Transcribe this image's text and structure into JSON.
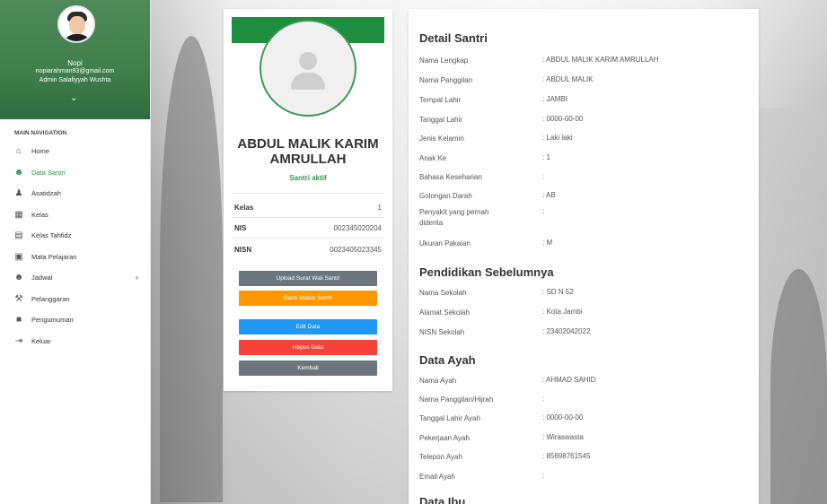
{
  "sidebar": {
    "user": {
      "name": "Nopi",
      "email": "nopiarahman93@gmail.com",
      "role": "Admin Salafiyyah Wushta"
    },
    "nav_header": "MAIN NAVIGATION",
    "items": [
      {
        "label": "Home",
        "icon": "home-icon"
      },
      {
        "label": "Data Santri",
        "icon": "users-icon"
      },
      {
        "label": "Asatidzah",
        "icon": "user-icon"
      },
      {
        "label": "Kelas",
        "icon": "building-icon"
      },
      {
        "label": "Kelas Tahfidz",
        "icon": "book-icon"
      },
      {
        "label": "Mata Pelajaran",
        "icon": "file-icon"
      },
      {
        "label": "Jadwal",
        "icon": "users-icon",
        "expand": "+"
      },
      {
        "label": "Pelanggaran",
        "icon": "gavel-icon"
      },
      {
        "label": "Pengumuman",
        "icon": "announcement-icon"
      },
      {
        "label": "Keluar",
        "icon": "logout-icon"
      }
    ]
  },
  "profile": {
    "name": "ABDUL MALIK KARIM AMRULLAH",
    "status": "Santri aktif",
    "kelas_label": "Kelas",
    "kelas_value": "1",
    "nis_label": "NIS",
    "nis_value": "002345020204",
    "nisn_label": "NISN",
    "nisn_value": "0023405023345",
    "buttons": {
      "upload": "Upload Surat Wali Santri",
      "ganti_status": "Ganti Status Santri",
      "edit": "Edit Data",
      "hapus": "Hapus Data",
      "kembali": "Kembali"
    }
  },
  "detail": {
    "santri_title": "Detail Santri",
    "santri": [
      {
        "label": "Nama Lengkap",
        "value": ": ABDUL MALIK KARIM AMRULLAH"
      },
      {
        "label": "Nama Panggilan",
        "value": ": ABDUL MALIK"
      },
      {
        "label": "Tempat Lahir",
        "value": ": JAMBI"
      },
      {
        "label": "Tanggal Lahir",
        "value": ": 0000-00-00"
      },
      {
        "label": "Jenis Kelamin",
        "value": ": Laki laki"
      },
      {
        "label": "Anak Ke",
        "value": ": 1"
      },
      {
        "label": "Bahasa Keseharian",
        "value": ":"
      },
      {
        "label": "Golongan Darah",
        "value": ": AB"
      },
      {
        "label": "Penyakit yang pernah diderita",
        "value": ":"
      },
      {
        "label": "Ukuran Pakaian",
        "value": ": M"
      }
    ],
    "pendidikan_title": "Pendidikan Sebelumnya",
    "pendidikan": [
      {
        "label": "Nama Sekolah",
        "value": ": SD N 52"
      },
      {
        "label": "Alamat Sekolah",
        "value": ": Kota Jambi"
      },
      {
        "label": "NISN Sekolah",
        "value": ": 23402042022"
      }
    ],
    "ayah_title": "Data Ayah",
    "ayah": [
      {
        "label": "Nama Ayah",
        "value": ": AHMAD SAHID"
      },
      {
        "label": "Nama Panggilan/Hijrah",
        "value": ":"
      },
      {
        "label": "Tanggal Lahir Ayah",
        "value": ": 0000-00-00"
      },
      {
        "label": "Pekerjaan Ayah",
        "value": ": Wiraswasta"
      },
      {
        "label": "Telepon Ayah",
        "value": ": 85698761545"
      },
      {
        "label": "Email Ayah",
        "value": ":"
      }
    ],
    "ibu_title": "Data Ibu"
  },
  "colors": {
    "brand_green": "#1e8e3e",
    "active_green": "#2f8f4a",
    "btn_gray": "#6c757d",
    "btn_orange": "#ff9800",
    "btn_blue": "#2196f3",
    "btn_red": "#f44336"
  }
}
